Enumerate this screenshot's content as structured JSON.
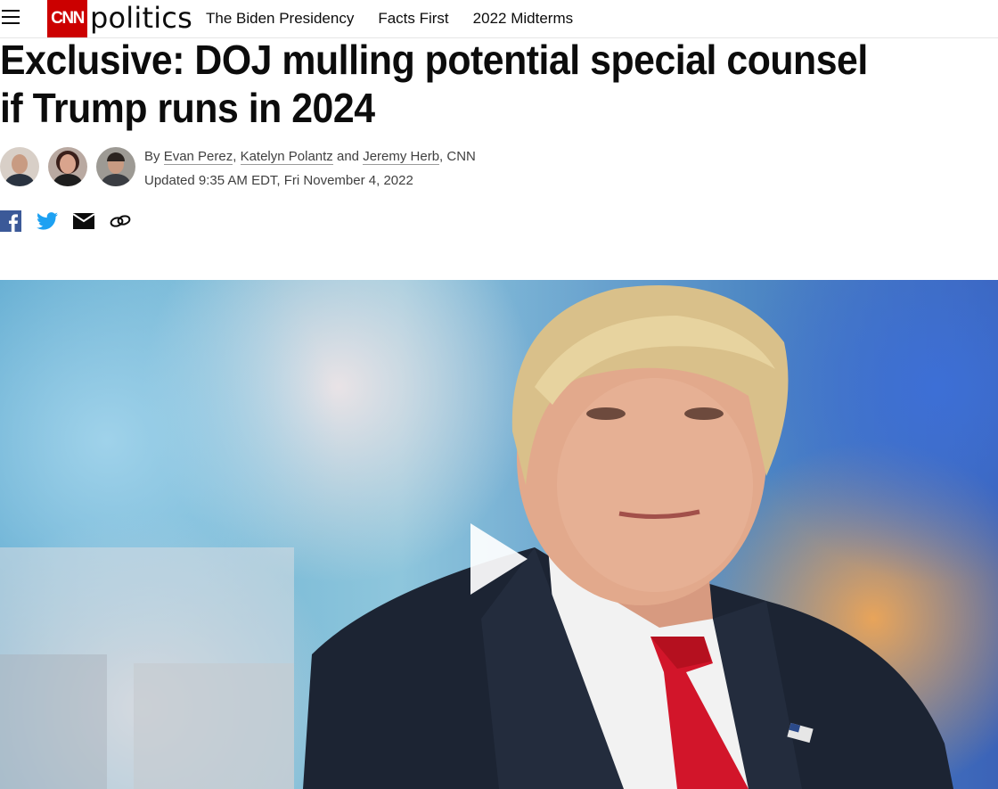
{
  "header": {
    "logo_box": "CNN",
    "logo_text": "politics",
    "nav": [
      "The Biden Presidency",
      "Facts First",
      "2022 Midterms"
    ]
  },
  "article": {
    "headline": "Exclusive: DOJ mulling potential special counsel if Trump runs in 2024",
    "byline": {
      "prefix": "By",
      "authors": [
        "Evan Perez",
        "Katelyn Polantz",
        "Jeremy Herb"
      ],
      "sep1": ",",
      "and": "and",
      "suffix": ", CNN"
    },
    "timestamp": "Updated 9:35 AM EDT, Fri November 4, 2022"
  },
  "share_icons": [
    "facebook-icon",
    "twitter-icon",
    "email-icon",
    "link-icon"
  ],
  "colors": {
    "brand_red": "#cc0000",
    "facebook": "#3b5998",
    "twitter": "#1da1f2"
  }
}
